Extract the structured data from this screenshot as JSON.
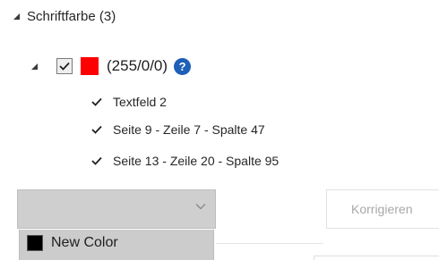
{
  "section": {
    "label": "Schriftfarbe (3)"
  },
  "color_group": {
    "label": "(255/0/0)",
    "swatch_color": "#ff0000",
    "checked": true,
    "help_icon": "question-mark-icon",
    "help_symbol": "?"
  },
  "occurrences": [
    {
      "label": "Textfeld 2",
      "checked": true
    },
    {
      "label": "Seite 9 - Zeile 7 - Spalte 47",
      "checked": true
    },
    {
      "label": "Seite 13 - Zeile 20 - Spalte 95",
      "checked": true
    }
  ],
  "color_dropdown": {
    "selected": "",
    "icon": "chevron-down-icon",
    "options": [
      {
        "label": "New Color",
        "swatch_color": "#000000"
      }
    ]
  },
  "actions": {
    "correct_label": "Korrigieren"
  }
}
